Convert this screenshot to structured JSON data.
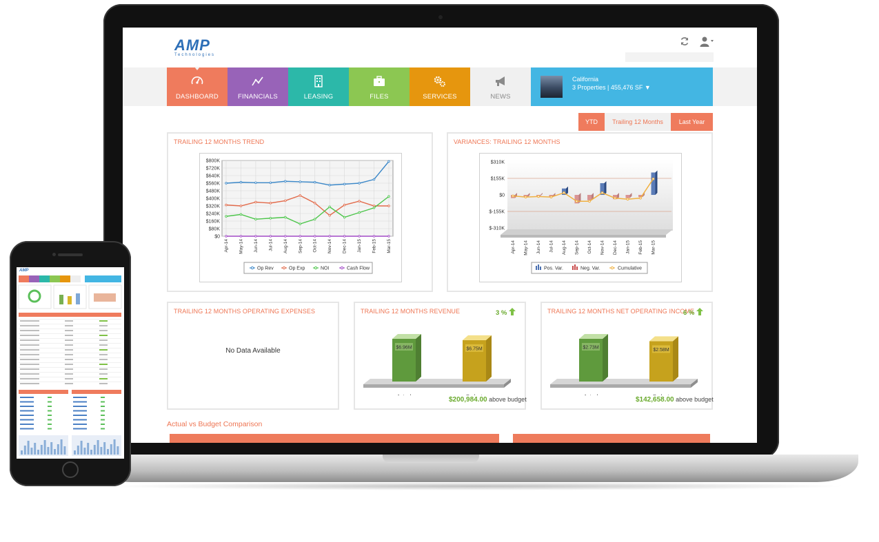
{
  "app": {
    "logo": "AMP",
    "logo_sub": "Technologies"
  },
  "nav": {
    "tabs": [
      {
        "label": "DASHBOARD",
        "icon": "gauge-icon",
        "color": "#ef7b5d"
      },
      {
        "label": "FINANCIALS",
        "icon": "line-chart-icon",
        "color": "#9863b8"
      },
      {
        "label": "LEASING",
        "icon": "building-icon",
        "color": "#2cb8a9"
      },
      {
        "label": "FILES",
        "icon": "briefcase-icon",
        "color": "#8cc752"
      },
      {
        "label": "SERVICES",
        "icon": "gears-icon",
        "color": "#e6960e"
      },
      {
        "label": "NEWS",
        "icon": "megaphone-icon",
        "color": "#f0f0f0"
      }
    ],
    "property": {
      "name": "California",
      "summary": "3 Properties | 455,476 SF ▼"
    }
  },
  "period": {
    "options": [
      "YTD",
      "Trailing 12 Months",
      "Last Year"
    ],
    "selected": "Trailing 12 Months"
  },
  "panels": {
    "trend": {
      "title": "TRAILING 12 MONTHS TREND"
    },
    "variances": {
      "title": "VARIANCES: TRAILING 12 MONTHS"
    },
    "opex": {
      "title": "TRAILING 12 MONTHS OPERATING EXPENSES",
      "message": "No Data Available"
    },
    "revenue": {
      "title": "TRAILING 12 MONTHS REVENUE",
      "change": "3 %",
      "actual_label": "$6.96M",
      "budget_label": "$6.75M",
      "diff": "$200,984.00",
      "diff_text": "above budget"
    },
    "noi": {
      "title": "TRAILING 12 MONTHS NET OPERATING INCOME",
      "change": "6 %",
      "actual_label": "$2.73M",
      "budget_label": "$2.58M",
      "diff": "$142,658.00",
      "diff_text": "above budget"
    }
  },
  "comparison": {
    "title": "Actual vs Budget Comparison"
  },
  "colors": {
    "accent": "#ee7553",
    "positive": "#6aaa2d",
    "property_bar": "#43b6e3"
  },
  "chart_data": [
    {
      "type": "line",
      "title": "TRAILING 12 MONTHS TREND",
      "categories": [
        "Apr-14",
        "May-14",
        "Jun-14",
        "Jul-14",
        "Aug-14",
        "Sep-14",
        "Oct-14",
        "Nov-14",
        "Dec-14",
        "Jan-15",
        "Feb-15",
        "Mar-15"
      ],
      "yticks": [
        "$0",
        "$80K",
        "$160K",
        "$240K",
        "$320K",
        "$400K",
        "$480K",
        "$560K",
        "$640K",
        "$720K",
        "$800K"
      ],
      "ylim": [
        0,
        800
      ],
      "series": [
        {
          "name": "Op Rev",
          "color": "#3a87c8",
          "values": [
            560,
            570,
            565,
            565,
            580,
            575,
            570,
            540,
            550,
            560,
            600,
            790
          ]
        },
        {
          "name": "Op Exp",
          "color": "#e26a4a",
          "values": [
            330,
            320,
            360,
            350,
            375,
            430,
            350,
            220,
            330,
            370,
            320,
            320
          ]
        },
        {
          "name": "NOI",
          "color": "#4cc54a",
          "values": [
            210,
            230,
            180,
            190,
            200,
            130,
            180,
            310,
            200,
            250,
            300,
            420
          ]
        },
        {
          "name": "Cash Flow",
          "color": "#a24bc7",
          "values": [
            0,
            0,
            0,
            0,
            0,
            0,
            0,
            0,
            0,
            0,
            0,
            0
          ]
        }
      ],
      "grid": true,
      "legend": "bottom"
    },
    {
      "type": "bar",
      "title": "VARIANCES: TRAILING 12 MONTHS",
      "categories": [
        "Apr-14",
        "May-14",
        "Jun-14",
        "Jul-14",
        "Aug-14",
        "Sep-14",
        "Oct-14",
        "Nov-14",
        "Dec-14",
        "Jan-15",
        "Feb-15",
        "Mar-15"
      ],
      "yticks": [
        "$-310K",
        "$-155K",
        "$0",
        "$155K",
        "$310K"
      ],
      "ylim": [
        -310,
        310
      ],
      "series": [
        {
          "name": "Pos. Var.",
          "color": "#4a6fb0",
          "values": [
            0,
            0,
            0,
            0,
            60,
            0,
            0,
            110,
            0,
            0,
            0,
            210
          ]
        },
        {
          "name": "Neg. Var.",
          "color": "#c84a4a",
          "values": [
            -30,
            -20,
            -10,
            -20,
            0,
            -80,
            -50,
            0,
            -40,
            -30,
            -20,
            0
          ]
        },
        {
          "name": "Cumulative",
          "color": "#f0b040",
          "values": [
            -10,
            -20,
            -15,
            -20,
            20,
            -60,
            -60,
            20,
            -30,
            -40,
            -30,
            150
          ]
        }
      ],
      "legend": "bottom"
    },
    {
      "type": "bar",
      "title": "TRAILING 12 MONTHS REVENUE",
      "categories": [
        "Actual",
        "Budget"
      ],
      "values": [
        6.96,
        6.75
      ],
      "data_labels": [
        "$6.96M",
        "$6.75M"
      ]
    },
    {
      "type": "bar",
      "title": "TRAILING 12 MONTHS NET OPERATING INCOME",
      "categories": [
        "Actual",
        "Budget"
      ],
      "values": [
        2.73,
        2.58
      ],
      "data_labels": [
        "$2.73M",
        "$2.58M"
      ]
    }
  ]
}
